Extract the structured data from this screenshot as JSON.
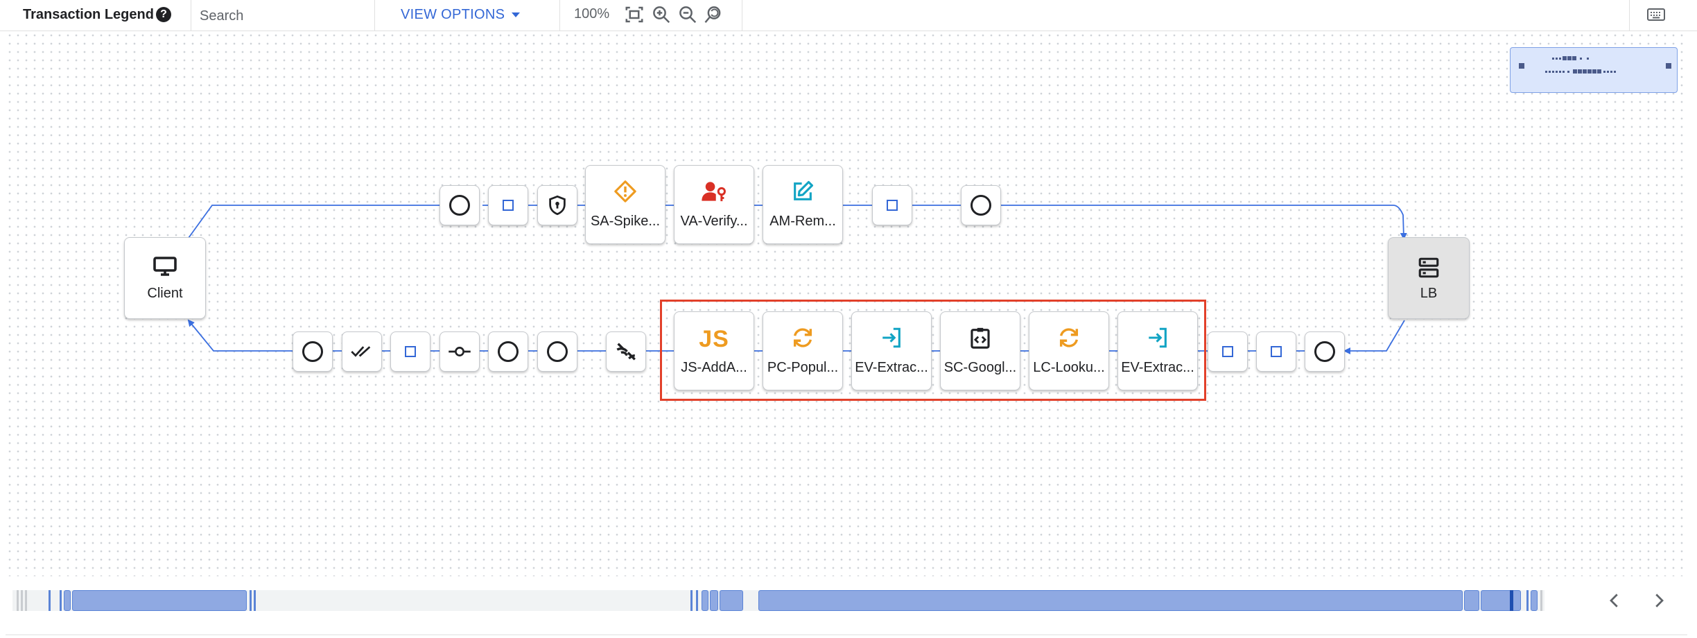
{
  "toolbar": {
    "legend_label": "Transaction Legend",
    "help_glyph": "?",
    "search_placeholder": "Search",
    "view_options_label": "VIEW OPTIONS",
    "zoom_level": "100%",
    "icons": [
      "fit-screen-icon",
      "zoom-in-icon",
      "zoom-out-icon",
      "zoom-reset-icon",
      "keyboard-icon"
    ]
  },
  "endpoints": {
    "client_label": "Client",
    "lb_label": "LB"
  },
  "top_flow": {
    "nodes": [
      {
        "type": "circle"
      },
      {
        "type": "diamond"
      },
      {
        "type": "shield"
      },
      {
        "type": "policy",
        "label": "SA-Spike...",
        "icon": "warning-icon",
        "color": "#ee9b20"
      },
      {
        "type": "policy",
        "label": "VA-Verify...",
        "icon": "person-key-icon",
        "color": "#d93025"
      },
      {
        "type": "policy",
        "label": "AM-Rem...",
        "icon": "edit-icon",
        "color": "#12a4c4"
      },
      {
        "type": "diamond"
      },
      {
        "type": "circle"
      }
    ]
  },
  "bottom_flow": {
    "nodes": [
      {
        "type": "circle"
      },
      {
        "type": "double-check"
      },
      {
        "type": "diamond"
      },
      {
        "type": "commit"
      },
      {
        "type": "circle"
      },
      {
        "type": "circle"
      },
      {
        "type": "fault"
      },
      {
        "type": "policy",
        "label": "JS-AddA...",
        "icon": "javascript-icon",
        "glyph": "JS",
        "color": "#ee9b20"
      },
      {
        "type": "policy",
        "label": "PC-Popul...",
        "icon": "sync-icon",
        "color": "#ee9b20"
      },
      {
        "type": "policy",
        "label": "EV-Extrac...",
        "icon": "login-icon",
        "color": "#12a4c4"
      },
      {
        "type": "policy",
        "label": "SC-Googl...",
        "icon": "code-clipboard-icon",
        "color": "#202124"
      },
      {
        "type": "policy",
        "label": "LC-Looku...",
        "icon": "sync-icon",
        "color": "#ee9b20"
      },
      {
        "type": "policy",
        "label": "EV-Extrac...",
        "icon": "login-icon",
        "color": "#12a4c4"
      },
      {
        "type": "diamond"
      },
      {
        "type": "diamond"
      },
      {
        "type": "circle"
      }
    ]
  },
  "colors": {
    "accent": "#3367d6",
    "highlight": "#e2402a",
    "edge": "#3b6fe0",
    "timeline_segment": "#8fa9e2"
  }
}
